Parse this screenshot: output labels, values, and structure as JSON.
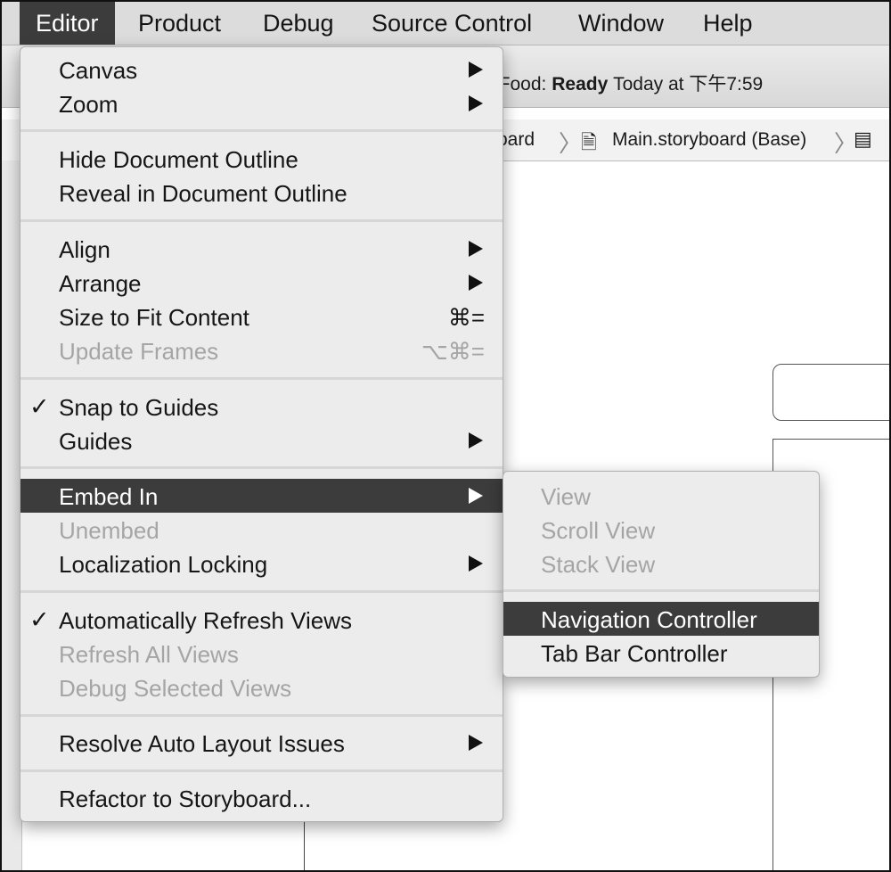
{
  "menubar": {
    "items": [
      "Editor",
      "Product",
      "Debug",
      "Source Control",
      "Window",
      "Help"
    ],
    "active": "Editor"
  },
  "status": {
    "project_partial": "aFood:",
    "state": "Ready",
    "time": "Today at 下午7:59"
  },
  "jumpbar": {
    "crumb_partial": "oard",
    "file": "Main.storyboard (Base)"
  },
  "editor_menu": {
    "canvas": "Canvas",
    "zoom": "Zoom",
    "hide_outline": "Hide Document Outline",
    "reveal_outline": "Reveal in Document Outline",
    "align": "Align",
    "arrange": "Arrange",
    "size_to_fit": "Size to Fit Content",
    "size_to_fit_shortcut": "⌘=",
    "update_frames": "Update Frames",
    "update_frames_shortcut": "⌥⌘=",
    "snap_to_guides": "Snap to Guides",
    "guides": "Guides",
    "embed_in": "Embed In",
    "unembed": "Unembed",
    "localization_locking": "Localization Locking",
    "auto_refresh": "Automatically Refresh Views",
    "refresh_all": "Refresh All Views",
    "debug_selected": "Debug Selected Views",
    "resolve_auto_layout": "Resolve Auto Layout Issues",
    "refactor": "Refactor to Storyboard...",
    "check": "✓"
  },
  "embed_submenu": {
    "view": "View",
    "scroll_view": "Scroll View",
    "stack_view": "Stack View",
    "navigation_controller": "Navigation Controller",
    "tab_bar_controller": "Tab Bar Controller"
  }
}
